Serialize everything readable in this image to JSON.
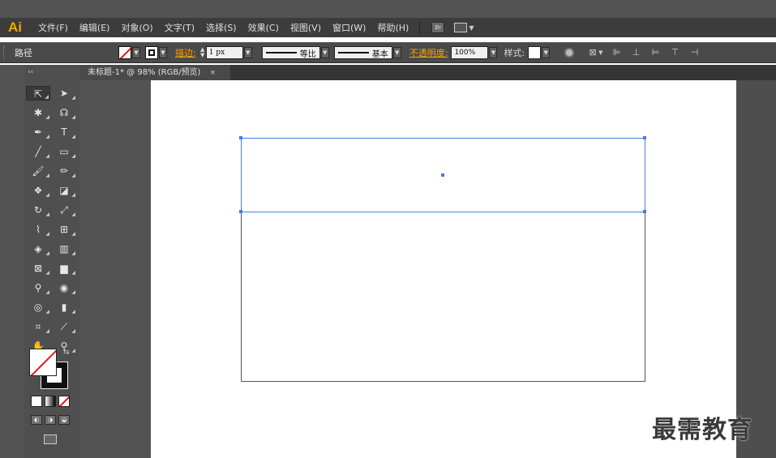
{
  "app": {
    "logo": "Ai",
    "menus": [
      "文件(F)",
      "编辑(E)",
      "对象(O)",
      "文字(T)",
      "选择(S)",
      "效果(C)",
      "视图(V)",
      "窗口(W)",
      "帮助(H)"
    ],
    "bridge_label": "Br"
  },
  "control": {
    "selection_type": "路径",
    "stroke_link": "描边:",
    "stroke_weight": "1 px",
    "stroke_ratio": "等比",
    "stroke_profile": "基本",
    "opacity_link": "不透明度:",
    "opacity_value": "100%",
    "style_label": "样式:"
  },
  "document": {
    "tab_title": "未标题-1* @ 98% (RGB/预览)",
    "tab_close": "×"
  },
  "tools": {
    "header": "‹‹",
    "items": [
      {
        "name": "selection-tool",
        "glyph": "⇱",
        "selected": true
      },
      {
        "name": "direct-selection-tool",
        "glyph": "➤"
      },
      {
        "name": "magic-wand-tool",
        "glyph": "✱"
      },
      {
        "name": "lasso-tool",
        "glyph": "☊"
      },
      {
        "name": "pen-tool",
        "glyph": "✒"
      },
      {
        "name": "type-tool",
        "glyph": "T"
      },
      {
        "name": "line-tool",
        "glyph": "╱"
      },
      {
        "name": "rectangle-tool",
        "glyph": "▭"
      },
      {
        "name": "paintbrush-tool",
        "glyph": "🖌"
      },
      {
        "name": "pencil-tool",
        "glyph": "✏"
      },
      {
        "name": "blob-brush-tool",
        "glyph": "❖"
      },
      {
        "name": "eraser-tool",
        "glyph": "◪"
      },
      {
        "name": "rotate-tool",
        "glyph": "↻"
      },
      {
        "name": "scale-tool",
        "glyph": "⤢"
      },
      {
        "name": "warp-tool",
        "glyph": "⌇"
      },
      {
        "name": "free-transform-tool",
        "glyph": "⊞"
      },
      {
        "name": "shape-builder-tool",
        "glyph": "◈"
      },
      {
        "name": "perspective-grid-tool",
        "glyph": "▥"
      },
      {
        "name": "mesh-tool",
        "glyph": "⊠"
      },
      {
        "name": "gradient-tool",
        "glyph": "▆"
      },
      {
        "name": "eyedropper-tool",
        "glyph": "⚲"
      },
      {
        "name": "blend-tool",
        "glyph": "◉"
      },
      {
        "name": "symbol-sprayer-tool",
        "glyph": "◎"
      },
      {
        "name": "column-graph-tool",
        "glyph": "▮"
      },
      {
        "name": "artboard-tool",
        "glyph": "⌗"
      },
      {
        "name": "slice-tool",
        "glyph": "⟋"
      },
      {
        "name": "hand-tool",
        "glyph": "✋"
      },
      {
        "name": "zoom-tool",
        "glyph": "⚲"
      }
    ]
  },
  "watermark": "最需教育",
  "colors": {
    "accent_orange": "#f7a400",
    "selection_blue": "#4a7be0"
  }
}
